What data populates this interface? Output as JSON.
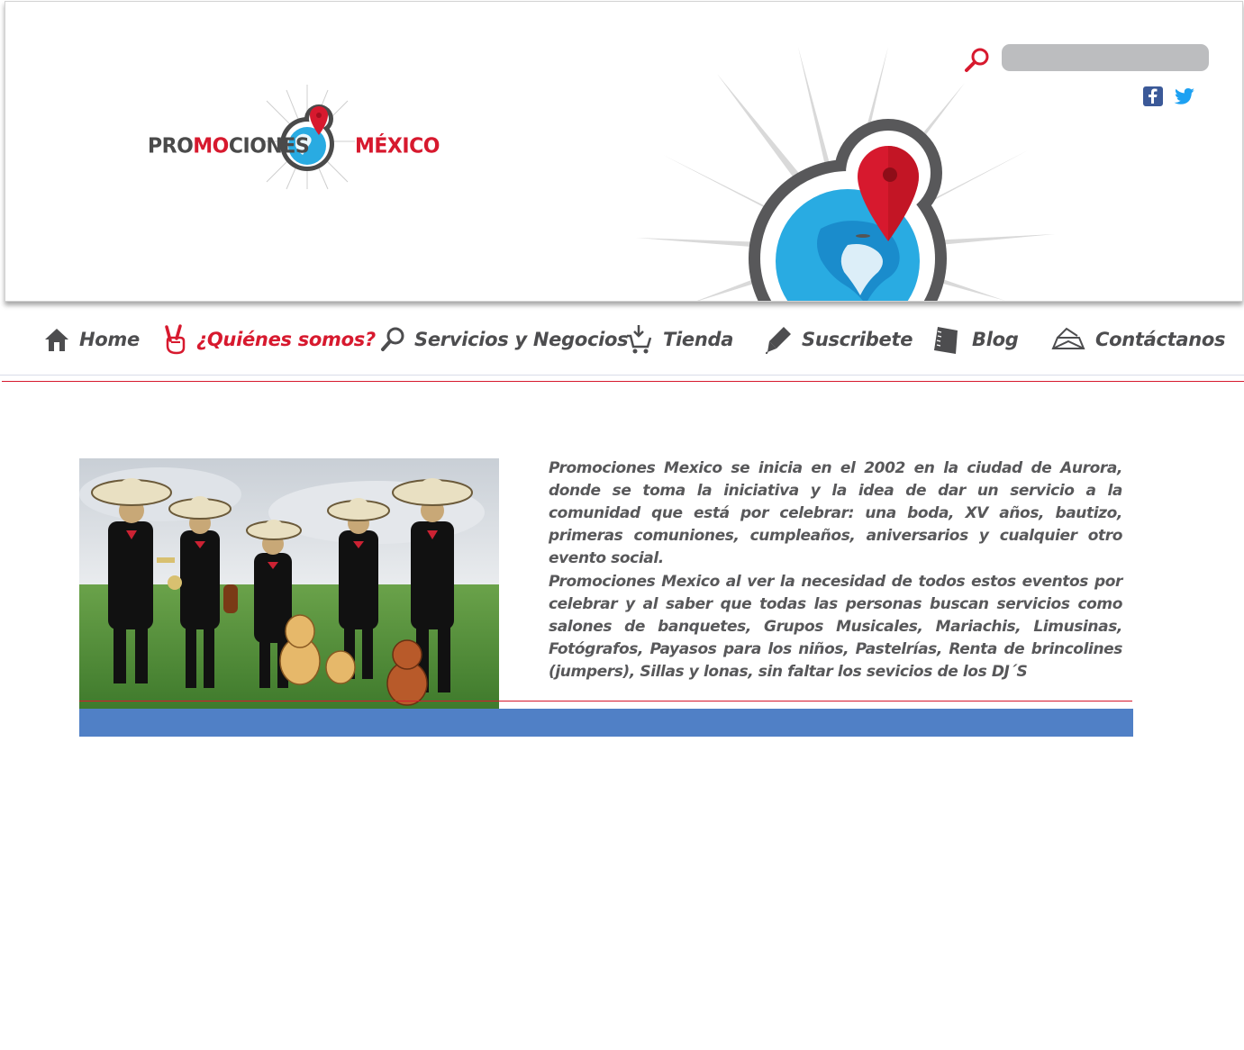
{
  "brand": {
    "left": {
      "pro": "PRO",
      "mo": "MO",
      "ciones": "CIONES"
    },
    "right": {
      "m": "M",
      "exico": "ÉXICO"
    }
  },
  "search": {
    "placeholder": "",
    "value": ""
  },
  "social": {
    "facebook": "facebook-icon",
    "twitter": "twitter-icon"
  },
  "nav": {
    "items": [
      {
        "label": "Home",
        "icon": "home-icon"
      },
      {
        "label": "¿Quiénes somos?",
        "icon": "peace-hand-icon",
        "active": true
      },
      {
        "label": "Servicios y Negocios",
        "icon": "search-icon"
      },
      {
        "label": "Tienda",
        "icon": "cart-icon"
      },
      {
        "label": "Suscribete",
        "icon": "pencil-icon"
      },
      {
        "label": "Blog",
        "icon": "notebook-icon"
      },
      {
        "label": "Contáctanos",
        "icon": "envelope-icon"
      }
    ]
  },
  "about": {
    "paragraph1": "Promociones Mexico se inicia en el 2002 en la ciudad de Aurora, donde se toma la iniciativa y la idea de dar un servicio a la comunidad que está por celebrar: una boda, XV años, bautizo, primeras comuniones, cumpleaños, aniversarios y cualquier otro evento social.",
    "paragraph2": "Promociones Mexico al ver la necesidad de todos estos eventos por celebrar y al saber que todas las personas buscan servicios como salones de banquetes, Grupos Musicales, Mariachis, Limusinas, Fotógrafos, Payasos para los niños, Pastelrías, Renta de brincolines (jumpers), Sillas y lonas, sin faltar los sevicios de los DJ´S"
  },
  "colors": {
    "accent_red": "#d7192e",
    "text_gray": "#4d4d4f",
    "globe_blue": "#29abe2",
    "bar_blue": "#5080c6",
    "search_gray": "#bcbdbf"
  }
}
